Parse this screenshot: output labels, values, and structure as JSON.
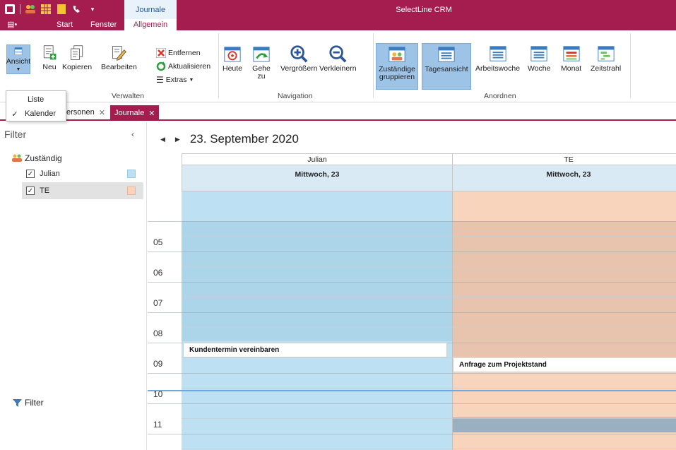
{
  "titlebar": {
    "app_title": "SelectLine CRM",
    "context_tab": "Journale",
    "qat_icons": [
      "app-logo-icon",
      "people-icon",
      "grid-icon",
      "note-icon",
      "phone-icon",
      "dropdown-arrow-icon"
    ]
  },
  "menu": {
    "tabs": [
      "Start",
      "Fenster"
    ],
    "active_tab": "Allgemein"
  },
  "ribbon": {
    "ansicht": "Ansicht",
    "neu": "Neu",
    "kopieren": "Kopieren",
    "bearbeiten": "Bearbeiten",
    "entfernen": "Entfernen",
    "aktualisieren": "Aktualisieren",
    "extras": "Extras",
    "heute": "Heute",
    "gehe_zu_1": "Gehe",
    "gehe_zu_2": "zu",
    "vergroessern": "Vergrößern",
    "verkleinern": "Verkleinern",
    "zustaendige_1": "Zuständige",
    "zustaendige_2": "gruppieren",
    "tagesansicht": "Tagesansicht",
    "arbeitswoche": "Arbeitswoche",
    "woche": "Woche",
    "monat": "Monat",
    "zeitstrahl": "Zeitstrahl",
    "groups": {
      "verwalten": "Verwalten",
      "navigation": "Navigation",
      "anordnen": "Anordnen"
    }
  },
  "dropdown": {
    "items": [
      {
        "label": "Liste",
        "checked": false
      },
      {
        "label": "Kalender",
        "checked": true
      }
    ]
  },
  "doctabs": {
    "tab1": "ersonen",
    "tab2": "Journale"
  },
  "filter_panel": {
    "title": "Filter",
    "group_label": "Zuständig",
    "rows": [
      {
        "name": "Julian",
        "checked": true,
        "color": "#bde0f2"
      },
      {
        "name": "TE",
        "checked": true,
        "color": "#f9d4bd"
      }
    ],
    "footer": "Filter"
  },
  "calendar": {
    "date_title": "23. September 2020",
    "columns": [
      {
        "person": "Julian",
        "day": "Mittwoch, 23",
        "color": "#bde0f2",
        "work_color": "#add5ea"
      },
      {
        "person": "TE",
        "day": "Mittwoch, 23",
        "color": "#f9d4bd",
        "work_color": "#e8c4ae"
      }
    ],
    "hours": [
      "05",
      "06",
      "07",
      "08",
      "09",
      "10",
      "11"
    ],
    "appointments": {
      "julian": "Kundentermin vereinbaren",
      "te": "Anfrage zum Projektstand"
    }
  },
  "colors": {
    "brand": "#a51d4e",
    "active_ribbon": "#9dc3e6"
  }
}
